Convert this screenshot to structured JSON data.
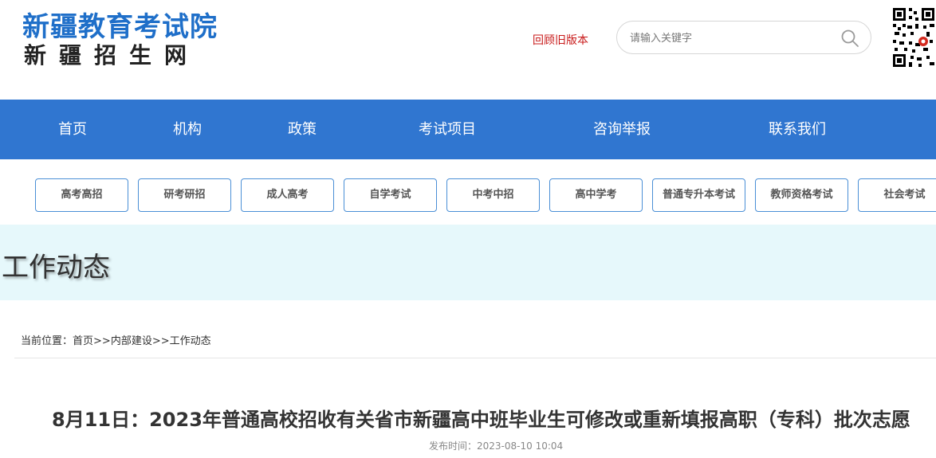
{
  "header": {
    "logo_main": "新疆教育考试院",
    "logo_sub": "新疆招生网",
    "old_version_link": "回顾旧版本",
    "search": {
      "placeholder": "请输入关键字",
      "value": ""
    }
  },
  "nav": {
    "items": [
      {
        "label": "首页"
      },
      {
        "label": "机构"
      },
      {
        "label": "政策"
      },
      {
        "label": "考试项目"
      },
      {
        "label": "咨询举报"
      },
      {
        "label": "联系我们"
      }
    ]
  },
  "categories": [
    {
      "label": "高考高招"
    },
    {
      "label": "研考研招"
    },
    {
      "label": "成人高考"
    },
    {
      "label": "自学考试"
    },
    {
      "label": "中考中招"
    },
    {
      "label": "高中学考"
    },
    {
      "label": "普通专升本考试"
    },
    {
      "label": "教师资格考试"
    },
    {
      "label": "社会考试"
    }
  ],
  "banner": {
    "title": "工作动态"
  },
  "breadcrumb": {
    "prefix": "当前位置：",
    "items": [
      "首页",
      "内部建设",
      "工作动态"
    ],
    "separator": ">>"
  },
  "article": {
    "title": "8月11日：2023年普通高校招收有关省市新疆高中班毕业生可修改或重新填报高职（专科）批次志愿",
    "publish_label": "发布时间：",
    "publish_time": "2023-08-10 10:04"
  },
  "colors": {
    "brand_blue": "#1f6fc9",
    "nav_blue": "#3076d0",
    "link_red": "#c81a1a",
    "banner_bg": "#e6f8fb"
  }
}
